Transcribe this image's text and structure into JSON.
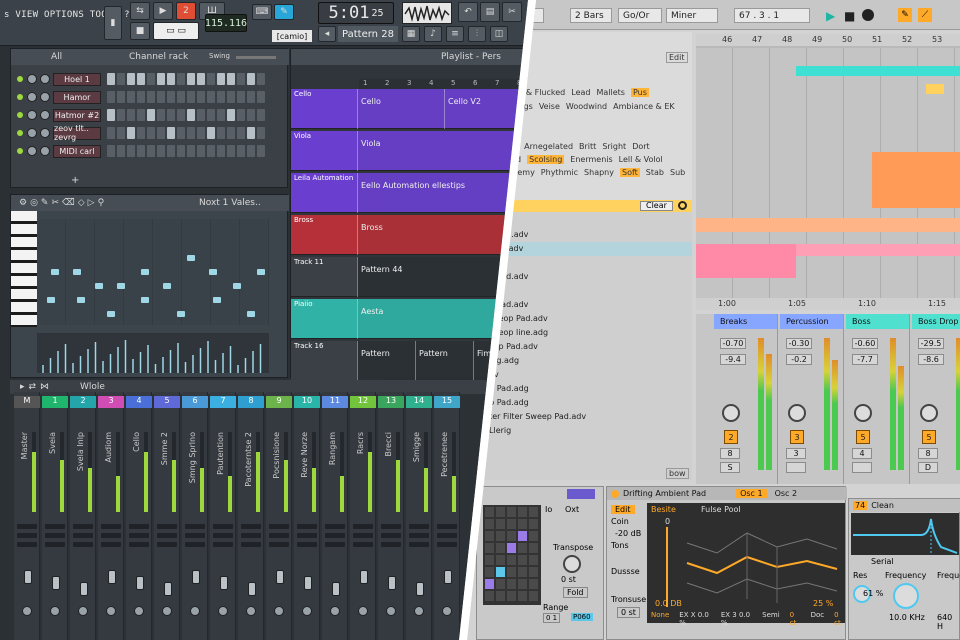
{
  "fl": {
    "menu": "s VIEW OPTIONS TOOLS ?",
    "bpm": "115.116",
    "time": "5:01",
    "time_small": "25",
    "pattern": "Pattern 28",
    "camio": "[camio]",
    "channel_rack": {
      "title": "Channel rack",
      "filter": "All",
      "swing": "Swing",
      "channels": [
        "Hoel 1",
        "Hamor",
        "Hatmor #2",
        "zeov tlt.. zevrg",
        "MIDI carl"
      ]
    },
    "piano_roll": {
      "title": "Noxt 1 Vales.."
    },
    "playlist": {
      "title": "Playlist - Pers",
      "track_labels": [
        "Cello",
        "Viola",
        "Leila Automation",
        "Bross",
        "Track 11",
        "Piaiio",
        "Track 16"
      ],
      "clip_labels": [
        "Cello",
        "Cello V2",
        "Viola",
        "Eello Automation ellestips",
        "Bross",
        "Pattern 44",
        "Aesta",
        "Pattern",
        "Pattern",
        "Fimthm"
      ],
      "ruler": [
        "1",
        "2",
        "3",
        "4",
        "5",
        "6",
        "7",
        "8"
      ]
    },
    "mixer": {
      "title": "Wlole",
      "channels": [
        "Master",
        "Sveia",
        "Svela Inlp",
        "Audiom",
        "Cello",
        "Smme 2",
        "Smng Sprlno",
        "Pautention",
        "Pacoterntse 2",
        "Pocsnisione",
        "Reve Norze",
        "Rangam",
        "Racrs",
        "Brecci",
        "Smigge",
        "Pecetrenee"
      ],
      "numbers": [
        "M",
        "1",
        "2",
        "3",
        "4",
        "5",
        "6",
        "7",
        "8",
        "9",
        "10",
        "11",
        "12",
        "13",
        "14",
        "15"
      ]
    },
    "colors": {
      "panel": "#2b3035",
      "purple": "#6a3fd0",
      "teal": "#30b3a6",
      "red": "#b53038",
      "green": "#9dd93d"
    }
  },
  "ab": {
    "transport": {
      "left_num": "4",
      "bars": "2 Bars",
      "key": "Go/Or",
      "scale": "Miner",
      "tempo": "67 . 3 . 1"
    },
    "tags": {
      "line1": [
        "ner & Flucked",
        "Lead",
        "Mallets",
        "Pus"
      ],
      "line2": [
        "ttings",
        "Veise",
        "Woodwind",
        "Ambiance & EK"
      ],
      "line3": [
        "s"
      ],
      "chars1": [
        "ng",
        "Arnegelated",
        "Britt",
        "Sright",
        "Dort"
      ],
      "chars2": [
        "ted",
        "Scolsing",
        "Enermenis",
        "Lell & Volol"
      ],
      "chars3": [
        "ertemy",
        "Phythmic",
        "Shapny",
        "Soft",
        "Stab",
        "Sub"
      ],
      "edit": "Edit"
    },
    "browser": {
      "clear": "Clear",
      "items": [
        "pp Pad.adv",
        "n Pad.adv",
        "v",
        "pp Pad.adv",
        "adv",
        "pp Pad.adv",
        "y Sleop Pad.adv",
        "y Sleop line.adg",
        "veop Pad.adv",
        "ning.adg",
        "adv",
        "pp Pad.adg",
        "pp Pad.adg",
        "nter Filter Sweep Pad.adv",
        "fiLlerig"
      ],
      "footer": "bow"
    },
    "arrangement": {
      "ruler_top": [
        "46",
        "47",
        "48",
        "49",
        "50",
        "51",
        "52",
        "53"
      ],
      "ruler_bottom": [
        "1:00",
        "1:05",
        "1:10",
        "1:15"
      ]
    },
    "mixer": {
      "channels": [
        {
          "name": "Breaks",
          "val1": "-0.70",
          "val2": "-9.4",
          "num": "2",
          "a": "8",
          "s": "S"
        },
        {
          "name": "Percussion",
          "val1": "-0.30",
          "val2": "-0.2",
          "num": "3",
          "a": "3",
          "s": ""
        },
        {
          "name": "Boss",
          "val1": "-0.60",
          "val2": "-7.7",
          "num": "5",
          "a": "4",
          "s": ""
        },
        {
          "name": "Boss Drop",
          "val1": "-29.5",
          "val2": "-8.6",
          "num": "5",
          "a": "8",
          "s": "D"
        }
      ]
    },
    "devices": {
      "io_labels": [
        "Io",
        "Oxt"
      ],
      "transpose": "Transpose",
      "transpose_val": "0 st",
      "fold": "Fold",
      "range": "Range",
      "range_vals": [
        "0 1",
        "P060"
      ],
      "rack_title": "Drifting Ambient Pad",
      "osc1": "Osc 1",
      "osc2": "Osc 2",
      "edit": "Edit",
      "coin": "Coin",
      "coin_val": "-20 dB",
      "tons": "Tons",
      "dusse": "Dussse",
      "transuse": "Tronsuse",
      "transuse_val": "0 st",
      "besite": "Besite",
      "pulse_pool": "Fulse Pool",
      "db_readout": "0.0 DB",
      "none": "None",
      "ex1": "EX X 0.0 %",
      "ex2": "EX 3 0.0 %",
      "semi": "Semi",
      "semi_val": "0 ct",
      "doc": "Doc",
      "doc_val": "0 ct",
      "pct": "25 %",
      "zero": "0",
      "filter": "Clean",
      "filter_num": "74",
      "serial": "Serial",
      "res": "Res",
      "res_val": "61 %",
      "freq": "Frequency",
      "freq_val": "10.0 KHz",
      "freq2": "Frequenc",
      "freq2_val": "640 H"
    },
    "colors": {
      "cyan": "#3fe0d4",
      "orange": "#ff9a57",
      "pink": "#ff8aa8",
      "amber": "#ffa928",
      "track_blue": "#86a6ff",
      "track_teal": "#4fe0d0"
    }
  }
}
